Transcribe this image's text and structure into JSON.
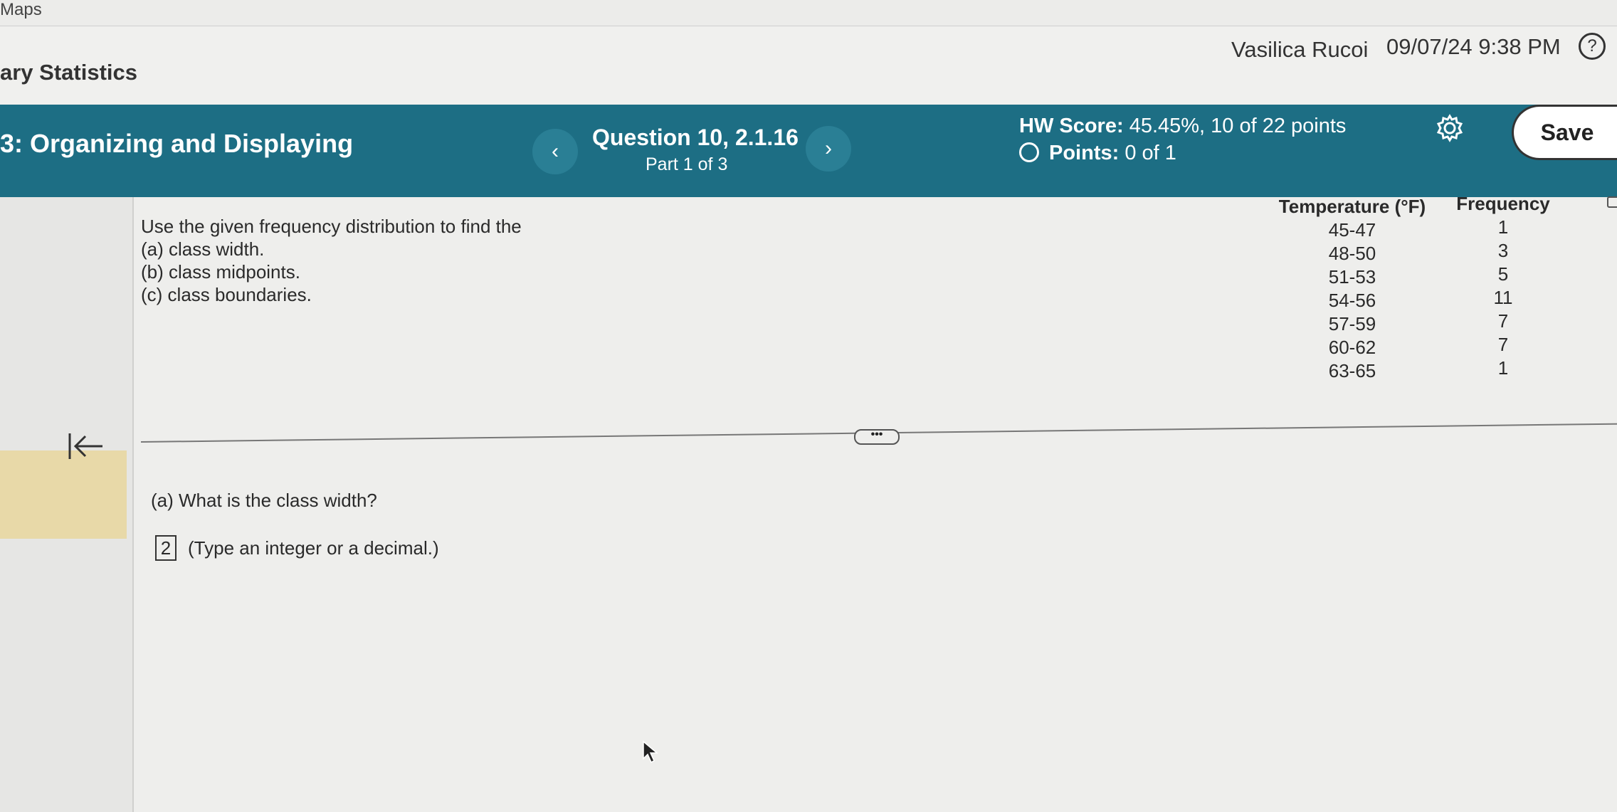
{
  "bookmarks": {
    "maps_label": "Maps"
  },
  "header": {
    "course_title": "ary Statistics",
    "user_name": "Vasilica Rucoi",
    "datetime": "09/07/24 9:38 PM",
    "help_glyph": "?"
  },
  "toolbar": {
    "section_title": "3: Organizing and Displaying",
    "prev_glyph": "‹",
    "next_glyph": "›",
    "question_title": "Question 10, 2.1.16",
    "question_part": "Part 1 of 3",
    "hw_score_label": "HW Score:",
    "hw_score_value": "45.45%, 10 of 22 points",
    "points_label": "Points:",
    "points_value": "0 of 1",
    "save_label": "Save"
  },
  "problem": {
    "lines": [
      "Use the given frequency distribution to find the",
      "(a) class width.",
      "(b) class midpoints.",
      "(c) class boundaries."
    ],
    "table": {
      "headers": [
        "Temperature (°F)",
        "Frequency"
      ],
      "rows": [
        [
          "45-47",
          "1"
        ],
        [
          "48-50",
          "3"
        ],
        [
          "51-53",
          "5"
        ],
        [
          "54-56",
          "11"
        ],
        [
          "57-59",
          "7"
        ],
        [
          "60-62",
          "7"
        ],
        [
          "63-65",
          "1"
        ]
      ]
    }
  },
  "divider": {
    "handle_glyph": "•••"
  },
  "answer": {
    "question": "(a) What is the class width?",
    "value": "2",
    "hint": "(Type an integer or a decimal.)"
  },
  "colors": {
    "toolbar_bg": "#1d6e84",
    "highlight": "#e8d9a8",
    "page_bg": "#eeeeec"
  },
  "icons": [
    "help-icon",
    "gear-icon",
    "collapse-left-icon",
    "mouse-cursor-icon"
  ]
}
